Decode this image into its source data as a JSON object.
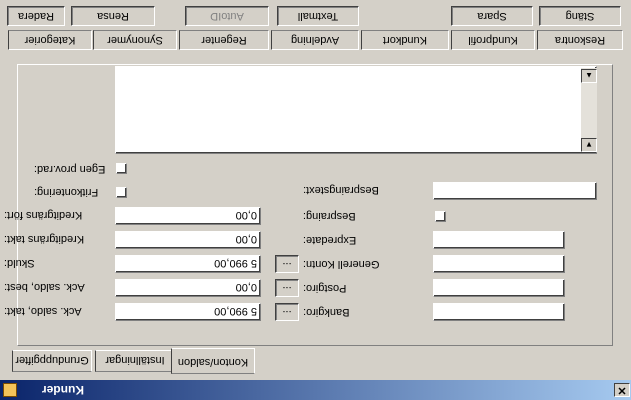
{
  "window": {
    "title": "Kunder",
    "close_glyph": "✕"
  },
  "toolbar": {
    "row1": [
      "Radera",
      "Rensa",
      "AutoID",
      "Textmall",
      "Spara",
      "Stäng"
    ],
    "row2": [
      "Kategorier",
      "Synonymer",
      "Regenter",
      "Avdelning",
      "Kundkort",
      "Kundprofil",
      "Reskontra"
    ]
  },
  "form": {
    "egen_prov_rad": "Egen prov.rad:",
    "fritkontering": "Fritkontering:",
    "kreditgrans_fort": "Kreditgräns fört:",
    "kreditgrans_takt": "Kreditgräns takt:",
    "skuld": "Skuld:",
    "ack_saldo_best": "Ack. saldo, best:",
    "ack_saldo_takt": "Ack. saldo, takt:",
    "kreditgrans_fort_value": "0,00",
    "kreditgrans_takt_value": "0,00",
    "skuld_value": "5 990,00",
    "ack_saldo_best_value": "0,00",
    "ack_saldo_takt_value": "5 990,00",
    "ellipsis": "...",
    "bespraringstext": "Bespraingstext:",
    "bespraring": "Bespraing:",
    "expredate": "Expredate:",
    "generell_kontn": "Generell Kontn:",
    "postgiro": "Postgiro:",
    "bankgiro": "Bankgiro:"
  },
  "bottom_tabs": [
    "Grunduppgifter",
    "Inställningar",
    "Konton/saldon"
  ]
}
